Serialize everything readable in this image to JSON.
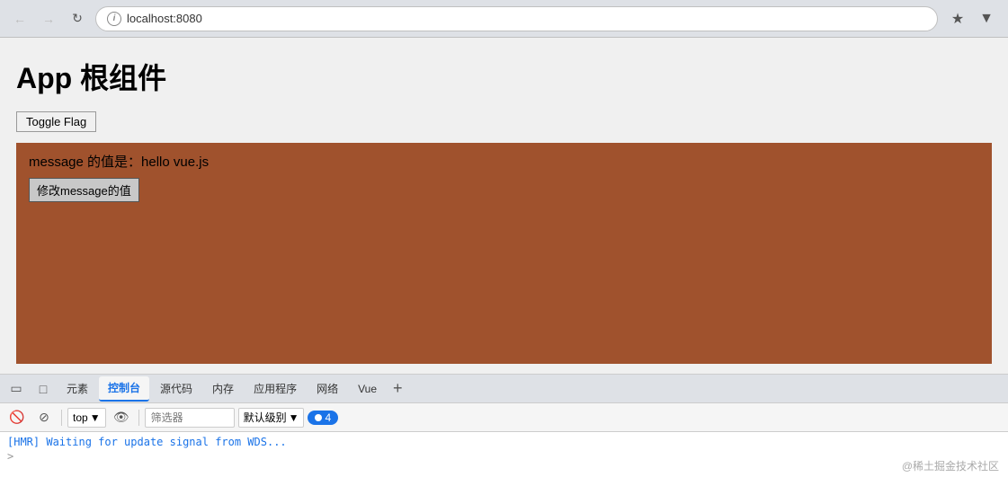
{
  "browser": {
    "url": "localhost:8080",
    "back_disabled": true,
    "forward_disabled": true
  },
  "page": {
    "title": "App 根组件",
    "toggle_button_label": "Toggle Flag",
    "message_label": "message 的值是：hello vue.js",
    "modify_button_label": "修改message的值"
  },
  "devtools": {
    "tabs": [
      {
        "id": "elements",
        "label": "元素"
      },
      {
        "id": "console",
        "label": "控制台",
        "active": true
      },
      {
        "id": "source",
        "label": "源代码"
      },
      {
        "id": "memory",
        "label": "内存"
      },
      {
        "id": "application",
        "label": "应用程序"
      },
      {
        "id": "network",
        "label": "网络"
      },
      {
        "id": "vue",
        "label": "Vue"
      }
    ],
    "toolbar": {
      "top_label": "top",
      "filter_placeholder": "筛选器",
      "level_label": "默认级别",
      "count": "4"
    },
    "console_line": "[HMR] Waiting for update signal from WDS...",
    "prompt": ">"
  },
  "watermark": "@稀土掘金技术社区"
}
